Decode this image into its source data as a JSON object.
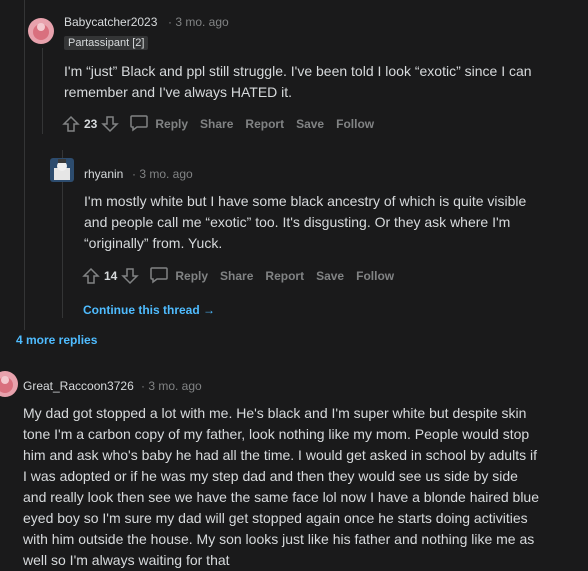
{
  "comments": [
    {
      "username": "Babycatcher2023",
      "time": "· 3 mo. ago",
      "flair": "Partassipant [2]",
      "body": "I'm “just” Black and ppl still struggle. I've been told I look “exotic” since I can remember and I've always HATED it.",
      "score": "23",
      "actions": [
        "Reply",
        "Share",
        "Report",
        "Save",
        "Follow"
      ]
    },
    {
      "username": "rhyanin",
      "time": "· 3 mo. ago",
      "body": "I'm mostly white but I have some black ancestry of which is quite visible and people call me “exotic” too. It's disgusting. Or they ask where I'm “originally” from. Yuck.",
      "score": "14",
      "actions": [
        "Reply",
        "Share",
        "Report",
        "Save",
        "Follow"
      ]
    },
    {
      "username": "Great_Raccoon3726",
      "time": "· 3 mo. ago",
      "body": "My dad got stopped a lot with me. He's black and I'm super white but despite skin tone I'm a carbon copy of my father, look nothing like my mom. People would stop him and ask who's baby he had all the time. I would get asked in school by adults if I was adopted or if he was my step dad and then they would see us side by side and really look then see we have the same face lol now I have a blonde haired blue eyed boy so I'm sure my dad will get stopped again once he starts doing activities with him outside the house. My son looks just like his father and nothing like me as well so I'm always waiting for that"
    }
  ],
  "continue_thread": "Continue this thread →",
  "more_replies": "4 more replies",
  "colors": {
    "background": "#1a1a1b",
    "link": "#4fbcff",
    "muted": "#818384",
    "text": "#d7dadc"
  }
}
